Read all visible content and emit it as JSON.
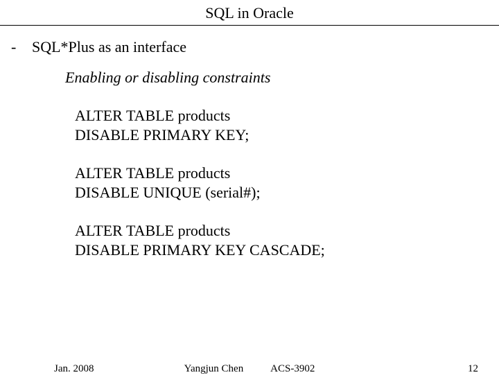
{
  "title": "SQL in Oracle",
  "bullet": {
    "marker": "-",
    "text": "SQL*Plus as an interface"
  },
  "subtitle": "Enabling or disabling constraints",
  "code": {
    "block1": {
      "line1": "ALTER TABLE products",
      "line2": "DISABLE PRIMARY KEY;"
    },
    "block2": {
      "line1": "ALTER TABLE products",
      "line2": "DISABLE UNIQUE (serial#);"
    },
    "block3": {
      "line1": " ALTER TABLE products",
      "line2": "DISABLE PRIMARY KEY CASCADE;"
    }
  },
  "footer": {
    "date": "Jan. 2008",
    "author": "Yangjun Chen",
    "course": "ACS-3902",
    "page": "12"
  }
}
